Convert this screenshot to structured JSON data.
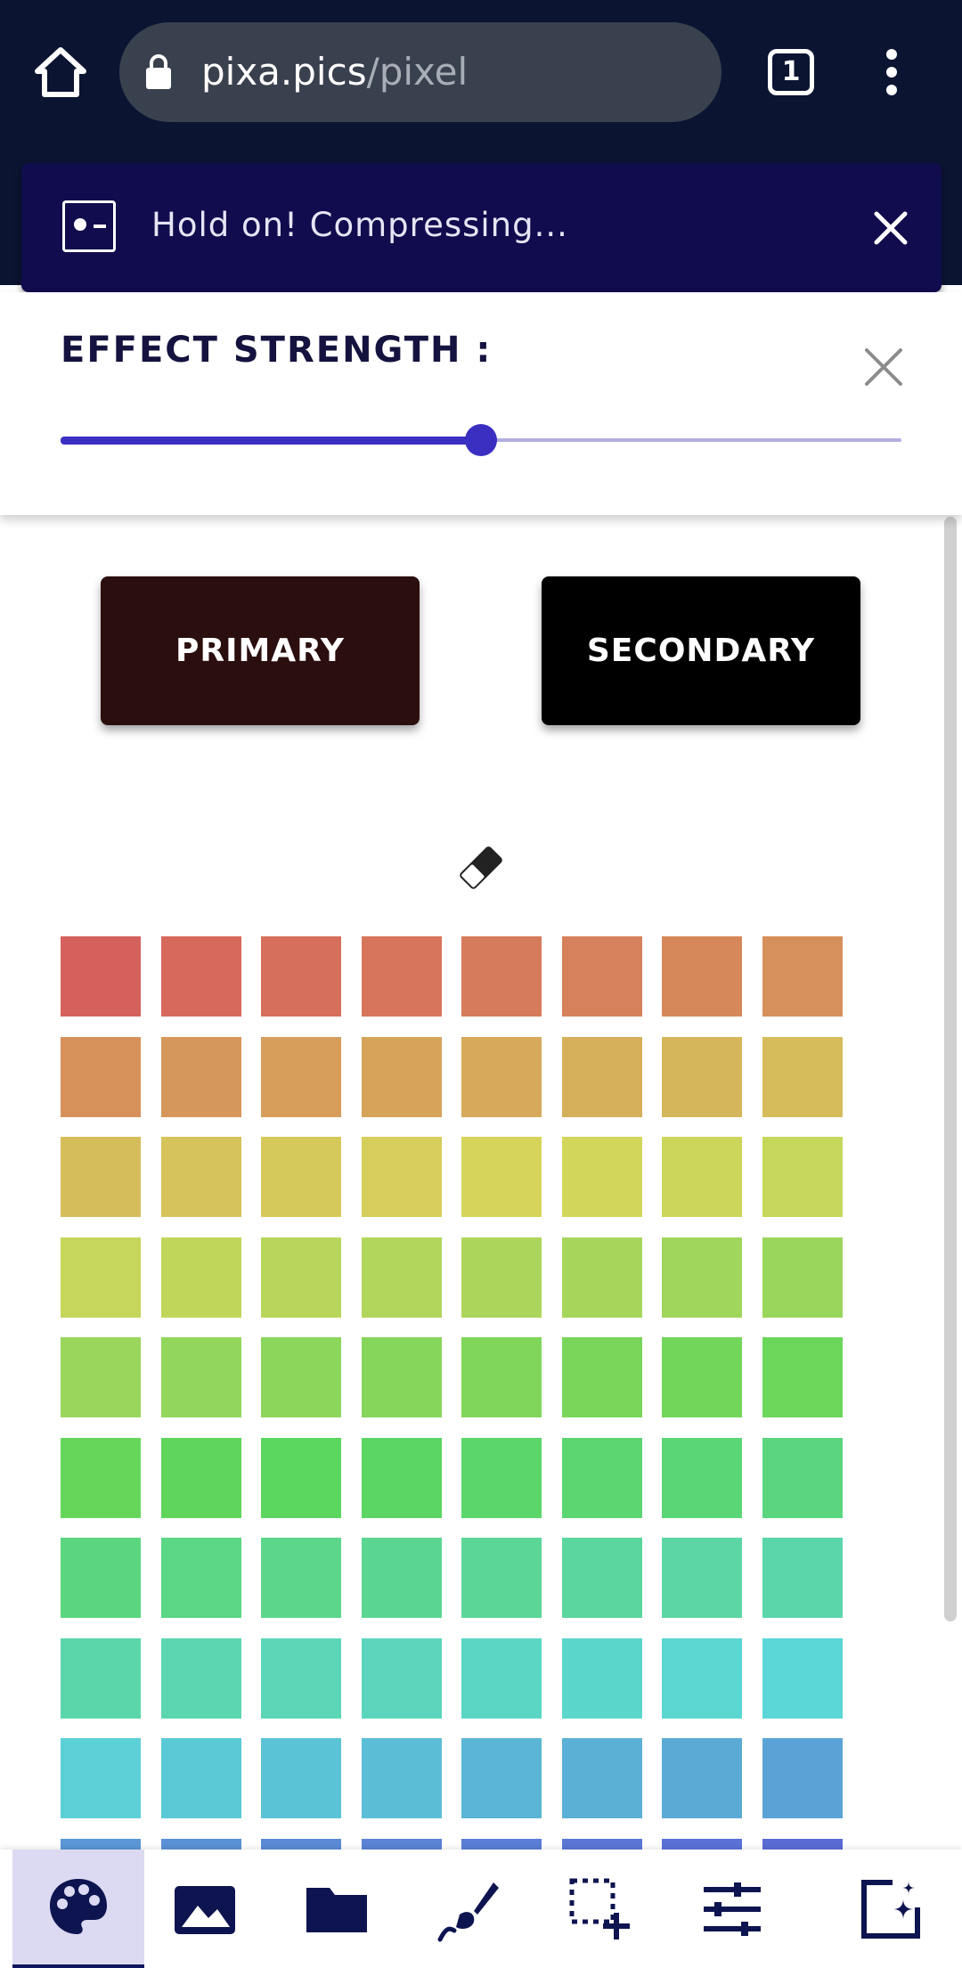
{
  "browser": {
    "url_domain": "pixa.pics",
    "url_path": "/pixel",
    "tab_count": "1"
  },
  "toast": {
    "message": "Hold on! Compressing..."
  },
  "effect": {
    "title": "EFFECT STRENGTH :",
    "strength_fraction": 0.5
  },
  "buttons": {
    "primary_label": "PRIMARY",
    "primary_color": "#2b0e0e",
    "secondary_label": "SECONDARY",
    "secondary_color": "#000000"
  },
  "palette": {
    "rows": [
      [
        "#d5615d",
        "#d6695b",
        "#d66f5b",
        "#d6755b",
        "#d67b5b",
        "#d6815b",
        "#d6885b",
        "#d6905b"
      ],
      [
        "#d6915b",
        "#d6975b",
        "#d69d5b",
        "#d6a35b",
        "#d6a95b",
        "#d6af5b",
        "#d6b65b",
        "#d6bc5b"
      ],
      [
        "#d6bd5b",
        "#d6c35b",
        "#d6c95b",
        "#d6ce5b",
        "#d6d45b",
        "#d2d65b",
        "#cbd65b",
        "#c5d65b"
      ],
      [
        "#c5d65b",
        "#bfd65b",
        "#b8d65b",
        "#b2d65b",
        "#acd65b",
        "#a5d65b",
        "#9fd65b",
        "#99d65b"
      ],
      [
        "#99d65b",
        "#92d65b",
        "#8cd65b",
        "#86d65b",
        "#7fd65b",
        "#79d65b",
        "#72d65b",
        "#6cd65b"
      ],
      [
        "#66d65b",
        "#5fd65b",
        "#5bd65e",
        "#5bd664",
        "#5bd66b",
        "#5bd671",
        "#5bd677",
        "#5bd67e"
      ],
      [
        "#5bd67e",
        "#5bd684",
        "#5bd68a",
        "#5bd691",
        "#5bd697",
        "#5bd69e",
        "#5bd6a4",
        "#5bd6aa"
      ],
      [
        "#5bd6aa",
        "#5bd6b1",
        "#5bd6b7",
        "#5bd6bd",
        "#5bd6c4",
        "#5bd6ca",
        "#5bd6d0",
        "#5bd6d6"
      ],
      [
        "#5bd0d6",
        "#5bc9d6",
        "#5bc3d6",
        "#5bbdd6",
        "#5bb6d6",
        "#5bb0d6",
        "#5baad6",
        "#5ba3d6"
      ],
      [
        "#5b97d6",
        "#5b91d6",
        "#5b8bd6",
        "#5b84d6",
        "#5b7ed6",
        "#5b77d6",
        "#5b71d6",
        "#5b6bd6"
      ]
    ]
  },
  "toolbar": {
    "items": [
      "palette-icon",
      "image-icon",
      "folder-icon",
      "brush-icon",
      "selection-add-icon",
      "tune-icon",
      "ai-image-icon"
    ],
    "active_index": 0,
    "icon_color": "#0d1450"
  }
}
